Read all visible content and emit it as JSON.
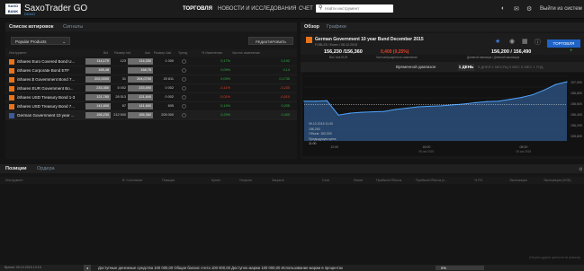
{
  "app": {
    "brand": "SaxoTrader GO",
    "logo_text_top": "SAXO",
    "logo_text_bottom": "BANK",
    "sub": "DEMO"
  },
  "nav": {
    "trade": "ТОРГОВЛЯ",
    "news": "НОВОСТИ И ИССЛЕДОВАНИЯ",
    "account": "СЧЕТ"
  },
  "search": {
    "placeholder": "Найти инструмент"
  },
  "header_icons": [
    "moon-icon",
    "mail-icon",
    "gear-icon"
  ],
  "logout": "Выйти из систем",
  "watchlist": {
    "title": "Список котировок",
    "tab": "Сигналы",
    "selected_list": "Popular Products",
    "edit_label": "РЕДАКТИРОВАТЬ",
    "columns": [
      "Инструмент",
      "Bid",
      "Размер bid",
      "Ask",
      "Размер Ask",
      "Тренд",
      "% Изменения",
      "Чистое изменение"
    ],
    "rows": [
      {
        "name": "iShares Euro Covered Bond U...",
        "bid": "114,170",
        "bid_size": "123",
        "ask": "114,330",
        "ask_size": "1 000",
        "pct": "0,17%",
        "net": "0,192",
        "dir": "up"
      },
      {
        "name": "iShares Corporate Bond ETF",
        "bid": "165,48",
        "bid_size": "",
        "ask": "166,76",
        "ask_size": "",
        "pct": "0,09%",
        "net": "0,14",
        "dir": "up"
      },
      {
        "name": "iShares $ Government Bond 7...",
        "bid": "202,0000",
        "bid_size": "31",
        "ask": "204,0700",
        "ask_size": "20 811",
        "pct": "0,09%",
        "net": "0,1735",
        "dir": "up"
      },
      {
        "name": "iShares EUR Government Bo...",
        "bid": "233,350",
        "bid_size": "5 002",
        "ask": "233,590",
        "ask_size": "0 002",
        "pct": "-0,11%",
        "net": "-0,235",
        "dir": "dn"
      },
      {
        "name": "iShares USD Treasury Bond 1-3",
        "bid": "121,780",
        "bid_size": "28 513",
        "ask": "121,840",
        "ask_size": "0 002",
        "pct": "-0,01%",
        "net": "-0,010",
        "dir": "dn"
      },
      {
        "name": "iShares USD Treasury Bond 7...",
        "bid": "141,600",
        "bid_size": "87",
        "ask": "141,660",
        "ask_size": "605",
        "pct": "0,14%",
        "net": "0,205",
        "dir": "up"
      },
      {
        "name": "German Government 10 year ...",
        "bid": "156,230",
        "bid_size": "212 500",
        "ask": "156,360",
        "ask_size": "205 000",
        "pct": "0,25%",
        "net": "0,400",
        "dir": "up"
      }
    ]
  },
  "overview": {
    "title": "Обзор",
    "tab": "Графики",
    "instrument": "German Government 10 year Bund December 2015",
    "instrument_sub": "FGBLZ5 / Eurex / 08.12.2015",
    "bid_ask": "156,230 /156,360",
    "bid_ask_label": "Bid / Ask EUR",
    "change": "0,400 (0,25%)",
    "change_label": "Чистое/процентное изменение",
    "range": "156,200 / 156,490",
    "range_label": "Дневной минимум / Дневной максимум",
    "trade_label": "ТОРГОВЛЯ",
    "time_range_label": "Временной диапазон",
    "time_range_active": "1 ДЕНЬ",
    "time_range_other": "5 ДНЕЙ   1 МЕСЯЦ   3 МЕС   6 МЕС   1 ГОД",
    "tooltip": [
      "09.10.2015 11:00",
      "156,260",
      "Объем: 152,000",
      "Предыдущая цена:",
      "11:00"
    ],
    "y_ticks": [
      "157,000",
      "156,800",
      "156,600",
      "156,400",
      "156,200",
      "155,800"
    ],
    "x_ticks": [
      "12:00",
      "18:00",
      "06:00"
    ],
    "x_dates": [
      "09.oкт.2015",
      "09.oкт.2015"
    ]
  },
  "chart_data": {
    "type": "line",
    "x": [
      "09:00",
      "10:00",
      "11:00",
      "12:00",
      "13:00",
      "14:00",
      "15:00",
      "16:00",
      "17:00",
      "18:00",
      "19:00",
      "20:00",
      "21:00",
      "22:00",
      "23:00",
      "00:00",
      "01:00",
      "02:00",
      "03:00",
      "04:00",
      "05:00",
      "06:00",
      "07:00",
      "08:00"
    ],
    "values": [
      156.56,
      156.56,
      156.57,
      156.26,
      156.3,
      156.32,
      156.33,
      156.34,
      156.38,
      156.41,
      156.44,
      156.45,
      156.46,
      156.48,
      156.5,
      156.53,
      156.55,
      156.56,
      156.6,
      156.64,
      156.7,
      156.8,
      156.92,
      156.98
    ],
    "ylim": [
      155.7,
      157.1
    ],
    "grid": true,
    "reference_line": 156.49
  },
  "positions": {
    "title": "Позиции",
    "tab": "Ордера",
    "columns": [
      "Инструмент",
      "В. Состояние",
      "Позиция",
      "Купил",
      "Открыть",
      "Закрыть",
      "Стоп",
      "Лимит",
      "Прибыль/Убыток",
      "Прибыль/Убыток (с...",
      "% P/L",
      "Экспозиция",
      "Экспозиция (USD)"
    ],
    "note": "(Опции и другие ценности не указаны)"
  },
  "footer": {
    "time": "Время: 09.10.2015  13:15",
    "button": "◂",
    "text": "Доступные денежные средства 100 000,00   Общая баланс счета 100 000,00   Доступно маржи 100 000,00   Использование маржи в процентах",
    "margin_pct": "0%"
  },
  "colors": {
    "accent": "#1f63c6",
    "up": "#2fb344",
    "down": "#e0412b",
    "chart_fill": "#2b4f7a",
    "chart_line": "#4ea3ff"
  }
}
